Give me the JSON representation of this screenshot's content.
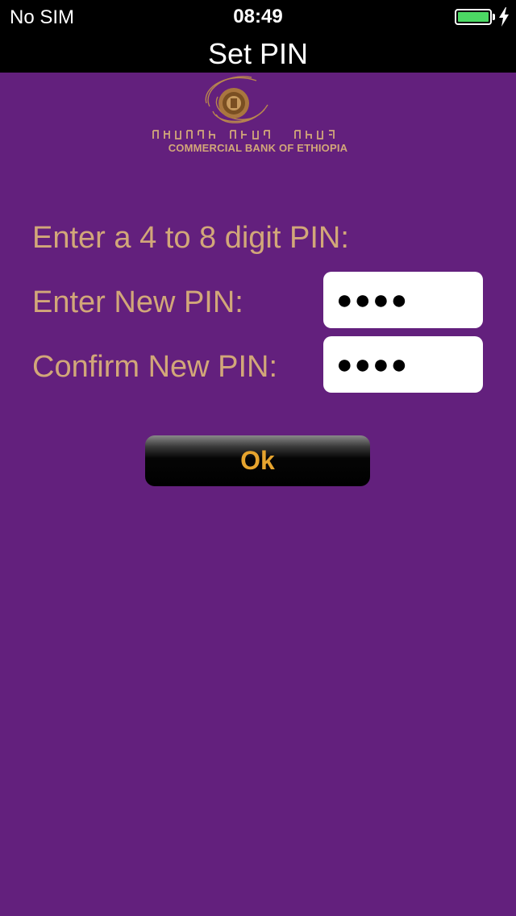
{
  "status_bar": {
    "carrier": "No SIM",
    "time": "08:49",
    "battery_level": 1.0,
    "battery_color": "#4cd964",
    "charging_icon": "bolt-icon"
  },
  "nav": {
    "title": "Set PIN"
  },
  "brand": {
    "logo_icon": "bank-emblem-icon",
    "amharic_name": "የኢትዮጵያ ንግድ ባንክ",
    "name": "COMMERCIAL BANK OF ETHIOPIA"
  },
  "form": {
    "instruction": "Enter a 4 to 8 digit PIN:",
    "new_pin_label": "Enter New PIN:",
    "new_pin_value": "●●●●",
    "confirm_pin_label": "Confirm New PIN:",
    "confirm_pin_value": "●●●●",
    "ok_label": "Ok"
  },
  "colors": {
    "background": "#63207d",
    "label_gold": "#d2a779",
    "button_text": "#e6a42e"
  }
}
